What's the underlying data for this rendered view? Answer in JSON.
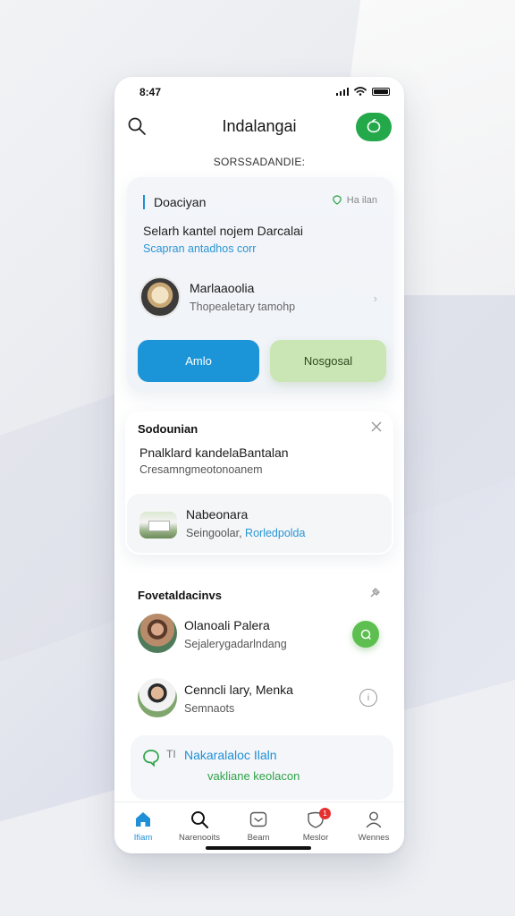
{
  "status": {
    "time": "8:47"
  },
  "header": {
    "title": "Indalangai",
    "search_icon": "search-icon",
    "action_icon": "chat-bubble-icon",
    "accent": "#23a84a"
  },
  "caption": "SORSSADANDIE:",
  "card1": {
    "title": "Doaciyan",
    "meta": "Ha ilan",
    "line1": "Selarh kantel nojem Darcalai",
    "link": "Scapran antadhos corr",
    "item": {
      "name": "Marlaaoolia",
      "sub": "Thopealetary tamohp"
    },
    "primary_button": "Amlo",
    "secondary_button": "Nosgosal"
  },
  "card2": {
    "title": "Sodounian",
    "line1": "Pnalklard kandelaBantalan",
    "line2": "Cresamngmeotonoanem",
    "item": {
      "name": "Nabeonara",
      "sub_plain": "Seingoolar,",
      "sub_highlight": "Rorledpolda"
    }
  },
  "card3": {
    "title": "Fovetaldacinvs",
    "contacts": [
      {
        "name": "Olanoali Palera",
        "sub": "Sejalerygadarlndang"
      },
      {
        "name": "Cenncli lary, Menka",
        "sub": "Semnaots"
      }
    ]
  },
  "promo": {
    "tag": "TI",
    "title": "Nakaralaloc Ilaln",
    "subtitle": "vakliane keolacon"
  },
  "tabs": [
    {
      "label": "Ifiam",
      "icon": "home-icon",
      "active": true
    },
    {
      "label": "Narenooits",
      "icon": "search-icon"
    },
    {
      "label": "Beam",
      "icon": "inbox-icon"
    },
    {
      "label": "Meslor",
      "icon": "shield-icon",
      "badge": "1"
    },
    {
      "label": "Wennes",
      "icon": "profile-icon"
    }
  ],
  "colors": {
    "primary": "#1b95d8",
    "secondary": "#c9e6b4",
    "green": "#5cbf4f",
    "badge": "#e53030"
  }
}
